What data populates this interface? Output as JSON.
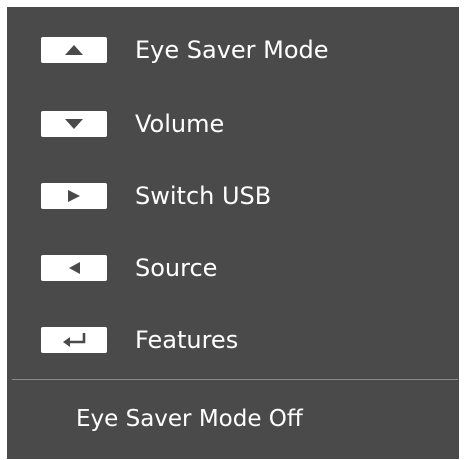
{
  "menu": {
    "items": [
      {
        "icon": "triangle-up-icon",
        "label": "Eye Saver Mode"
      },
      {
        "icon": "triangle-down-icon",
        "label": "Volume"
      },
      {
        "icon": "triangle-right-icon",
        "label": "Switch USB"
      },
      {
        "icon": "triangle-left-icon",
        "label": "Source"
      },
      {
        "icon": "enter-return-icon",
        "label": "Features"
      }
    ]
  },
  "status": {
    "text": "Eye Saver Mode Off"
  },
  "colors": {
    "panel_background": "#4a4a4a",
    "text": "#ffffff",
    "key_background": "#ffffff",
    "key_glyph": "#4a4a4a",
    "divider": "#8a8a8a"
  }
}
